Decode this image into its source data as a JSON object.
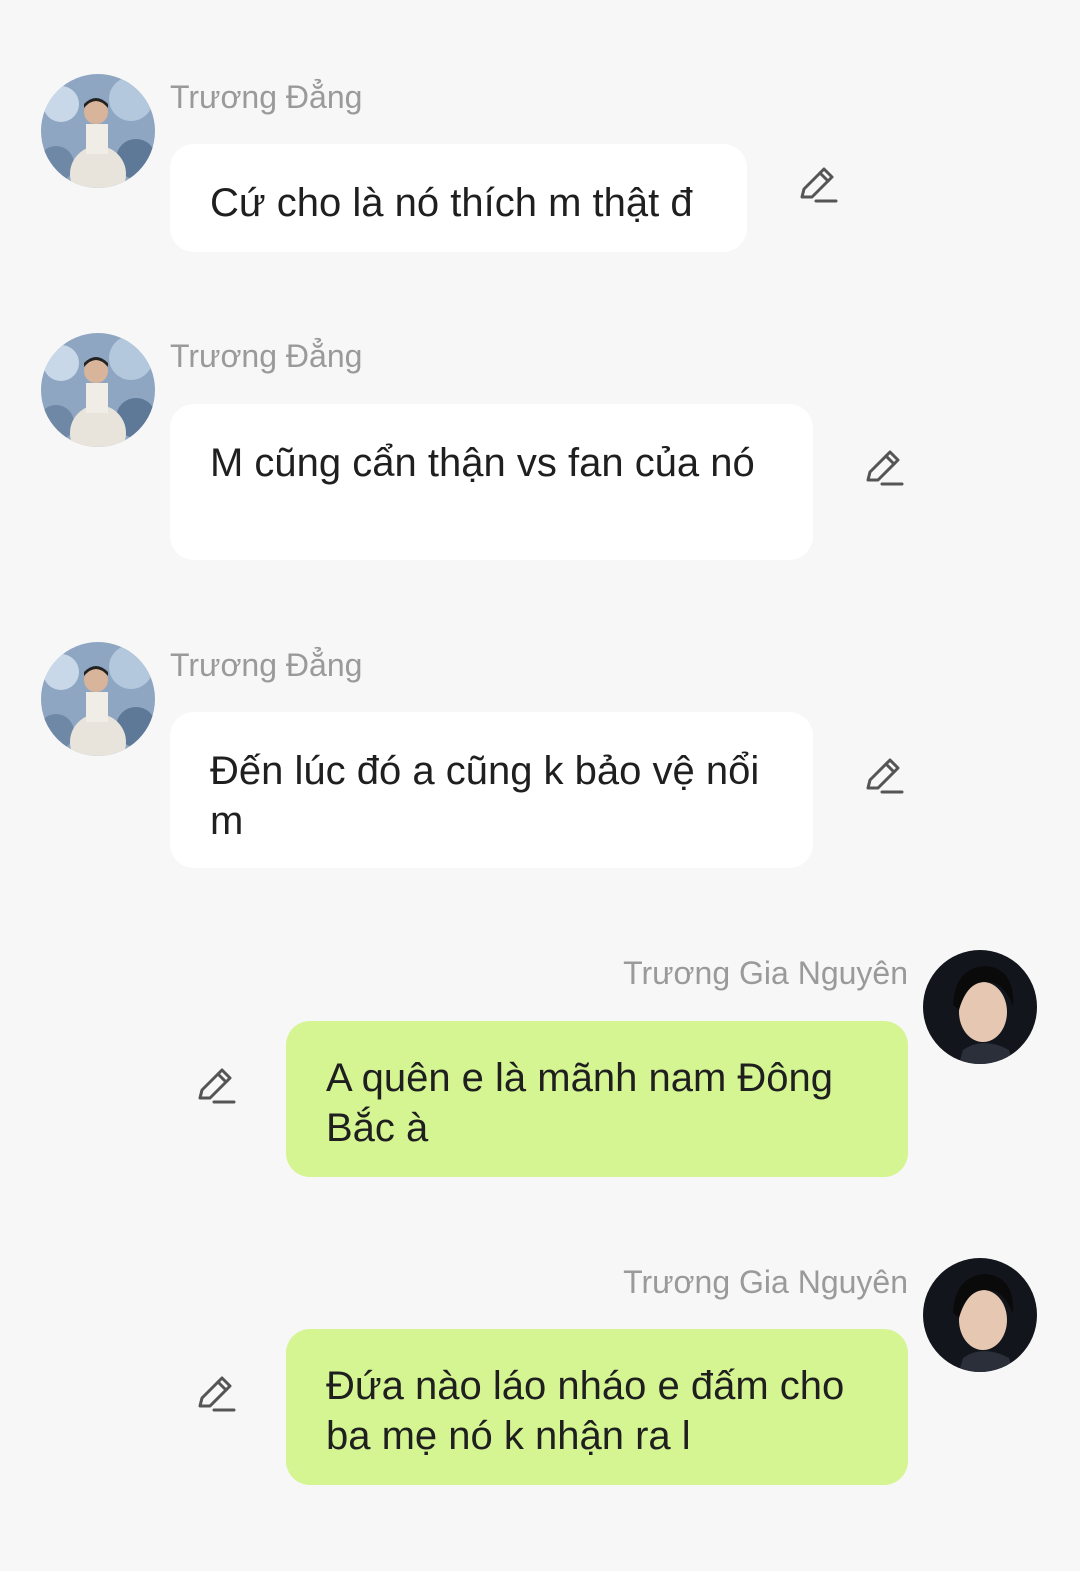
{
  "messages": [
    {
      "sender": "Trương Đẳng",
      "text": "Cứ cho là nó thích m thật đ",
      "direction": "incoming",
      "avatar": "avatar-truong-dang"
    },
    {
      "sender": "Trương Đẳng",
      "text": "M cũng cẩn thận vs fan của nó",
      "direction": "incoming",
      "avatar": "avatar-truong-dang"
    },
    {
      "sender": "Trương Đẳng",
      "text": "Đến lúc đó a cũng k bảo vệ nổi m",
      "direction": "incoming",
      "avatar": "avatar-truong-dang"
    },
    {
      "sender": "Trương Gia Nguyên",
      "text": "A quên e là mãnh nam Đông Bắc à",
      "direction": "outgoing",
      "avatar": "avatar-truong-gia-nguyen"
    },
    {
      "sender": "Trương Gia Nguyên",
      "text": "Đứa nào láo nháo e đấm cho ba mẹ nó k nhận ra l",
      "direction": "outgoing",
      "avatar": "avatar-truong-gia-nguyen"
    }
  ],
  "icons": {
    "edit": "pencil-edit-icon"
  },
  "colors": {
    "background": "#f7f7f7",
    "incoming_bubble": "#ffffff",
    "outgoing_bubble": "#d5f593",
    "sender_name": "#9a9a9a",
    "message_text": "#1f1f1f"
  }
}
